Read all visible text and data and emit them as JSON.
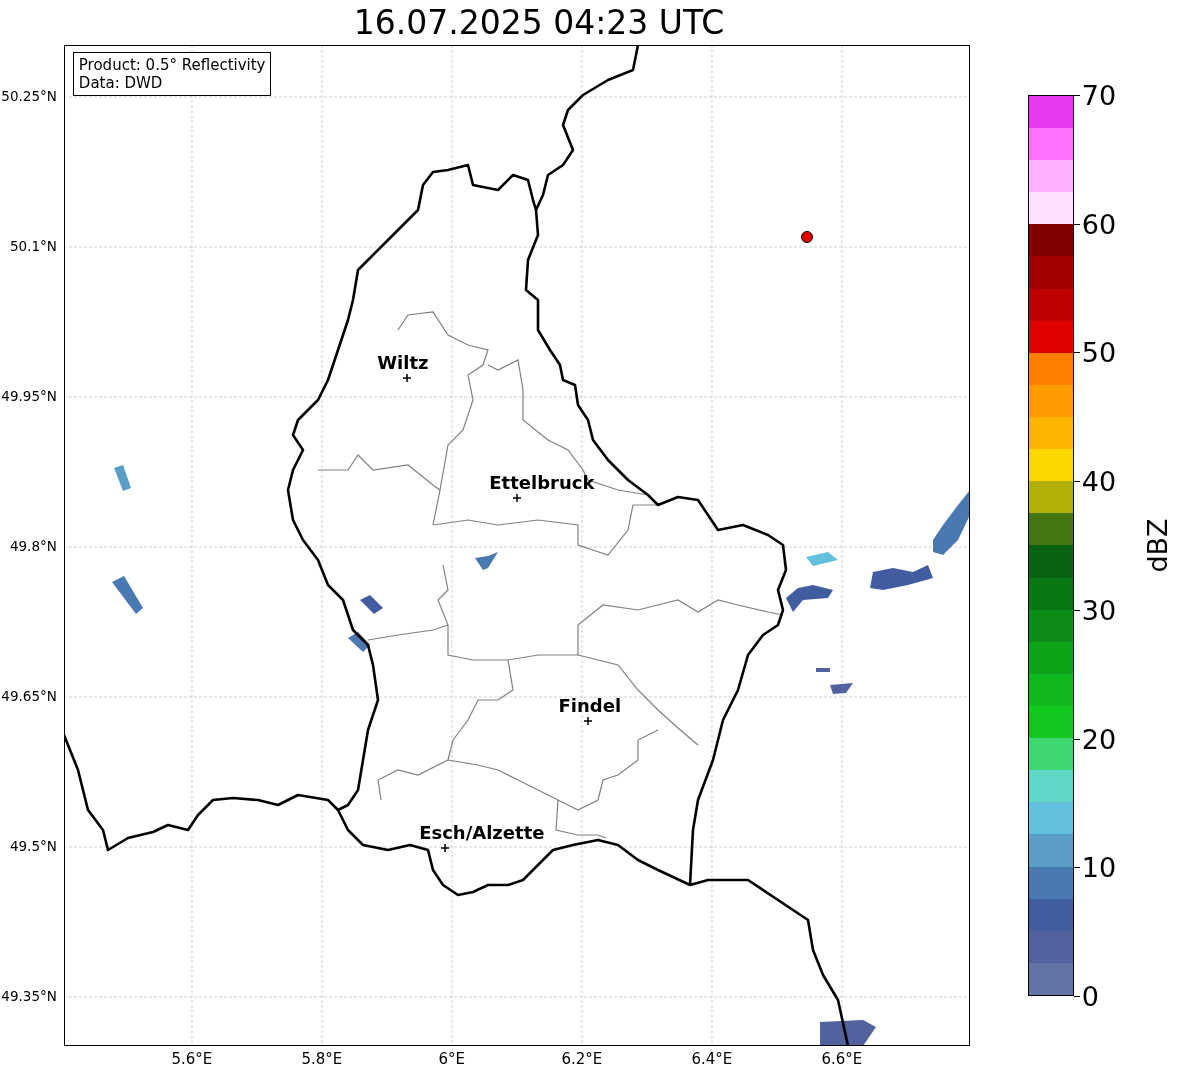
{
  "title": "16.07.2025 04:23 UTC",
  "info_box": [
    "Product: 0.5° Reflectivity",
    "Data: DWD"
  ],
  "y_ticks": [
    "50.25°N",
    "50.1°N",
    "49.95°N",
    "49.8°N",
    "49.65°N",
    "49.5°N",
    "49.35°N"
  ],
  "x_ticks": [
    "5.6°E",
    "5.8°E",
    "6°E",
    "6.2°E",
    "6.4°E",
    "6.6°E"
  ],
  "cities": [
    {
      "name": "Wiltz"
    },
    {
      "name": "Ettelbruck"
    },
    {
      "name": "Findel"
    },
    {
      "name": "Esch/Alzette"
    }
  ],
  "colorbar": {
    "label": "dBZ",
    "ticks": [
      "70",
      "60",
      "50",
      "40",
      "30",
      "20",
      "10",
      "0"
    ],
    "bands": [
      {
        "color": "#6473a6"
      },
      {
        "color": "#52629e"
      },
      {
        "color": "#425ca0"
      },
      {
        "color": "#4a78b0"
      },
      {
        "color": "#5a9ec8"
      },
      {
        "color": "#63c0dc"
      },
      {
        "color": "#60d8c8"
      },
      {
        "color": "#3dd670"
      },
      {
        "color": "#12c81e"
      },
      {
        "color": "#10b81e"
      },
      {
        "color": "#0ea41a"
      },
      {
        "color": "#0c8c16"
      },
      {
        "color": "#0a7812"
      },
      {
        "color": "#086410"
      },
      {
        "color": "#467612"
      },
      {
        "color": "#b0b008"
      },
      {
        "color": "#ffd700"
      },
      {
        "color": "#ffb400"
      },
      {
        "color": "#ff9a00"
      },
      {
        "color": "#ff7f00"
      },
      {
        "color": "#e00000"
      },
      {
        "color": "#c00000"
      },
      {
        "color": "#a00000"
      },
      {
        "color": "#800000"
      },
      {
        "color": "#ffe0ff"
      },
      {
        "color": "#ffb0ff"
      },
      {
        "color": "#ff70ff"
      },
      {
        "color": "#e838f0"
      }
    ]
  }
}
